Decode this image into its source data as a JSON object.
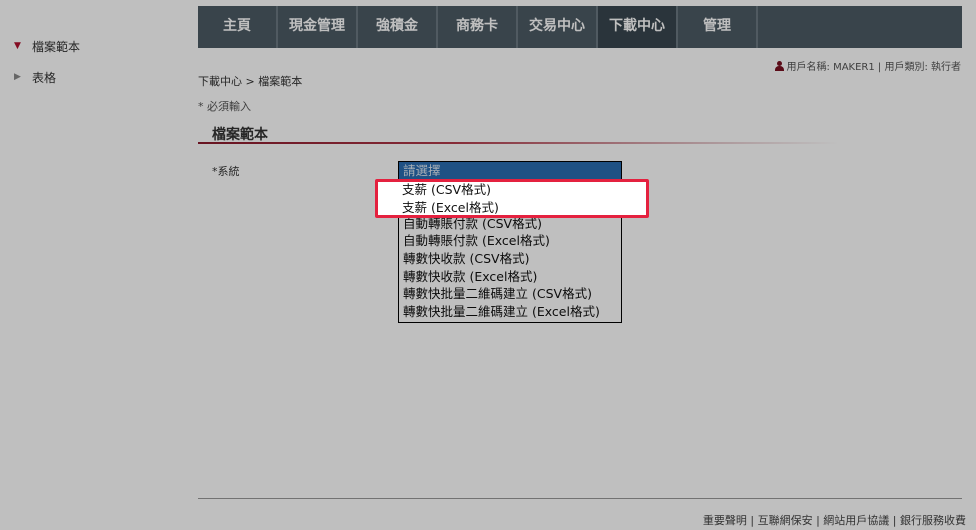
{
  "sidebar": {
    "items": [
      {
        "label": "檔案範本",
        "active": true
      },
      {
        "label": "表格",
        "active": false
      }
    ]
  },
  "nav": {
    "tabs": [
      "主頁",
      "現金管理",
      "強積金",
      "商務卡",
      "交易中心",
      "下載中心",
      "管理"
    ],
    "active": "下載中心"
  },
  "user": {
    "info": "用戶名稱: MAKER1 | 用戶類別: 執行者"
  },
  "breadcrumb": "下載中心 > 檔案範本",
  "required_note": "* 必須輸入",
  "section_title": "檔案範本",
  "form": {
    "system_label": "*系統",
    "options": [
      "請選擇",
      "支薪 (CSV格式)",
      "支薪 (Excel格式)",
      "自動轉賬付款 (CSV格式)",
      "自動轉賬付款 (Excel格式)",
      "轉數快收款 (CSV格式)",
      "轉數快收款 (Excel格式)",
      "轉數快批量二維碼建立 (CSV格式)",
      "轉數快批量二維碼建立 (Excel格式)"
    ],
    "selected": "請選擇"
  },
  "footer": {
    "links": [
      "重要聲明",
      "互聯網保安",
      "網站用戶協議",
      "銀行服務收費"
    ]
  },
  "colors": {
    "nav_bg": "#4d5b65",
    "accent": "#b0102e",
    "highlight": "#e4213f",
    "selected_option": "#2a6db0"
  }
}
